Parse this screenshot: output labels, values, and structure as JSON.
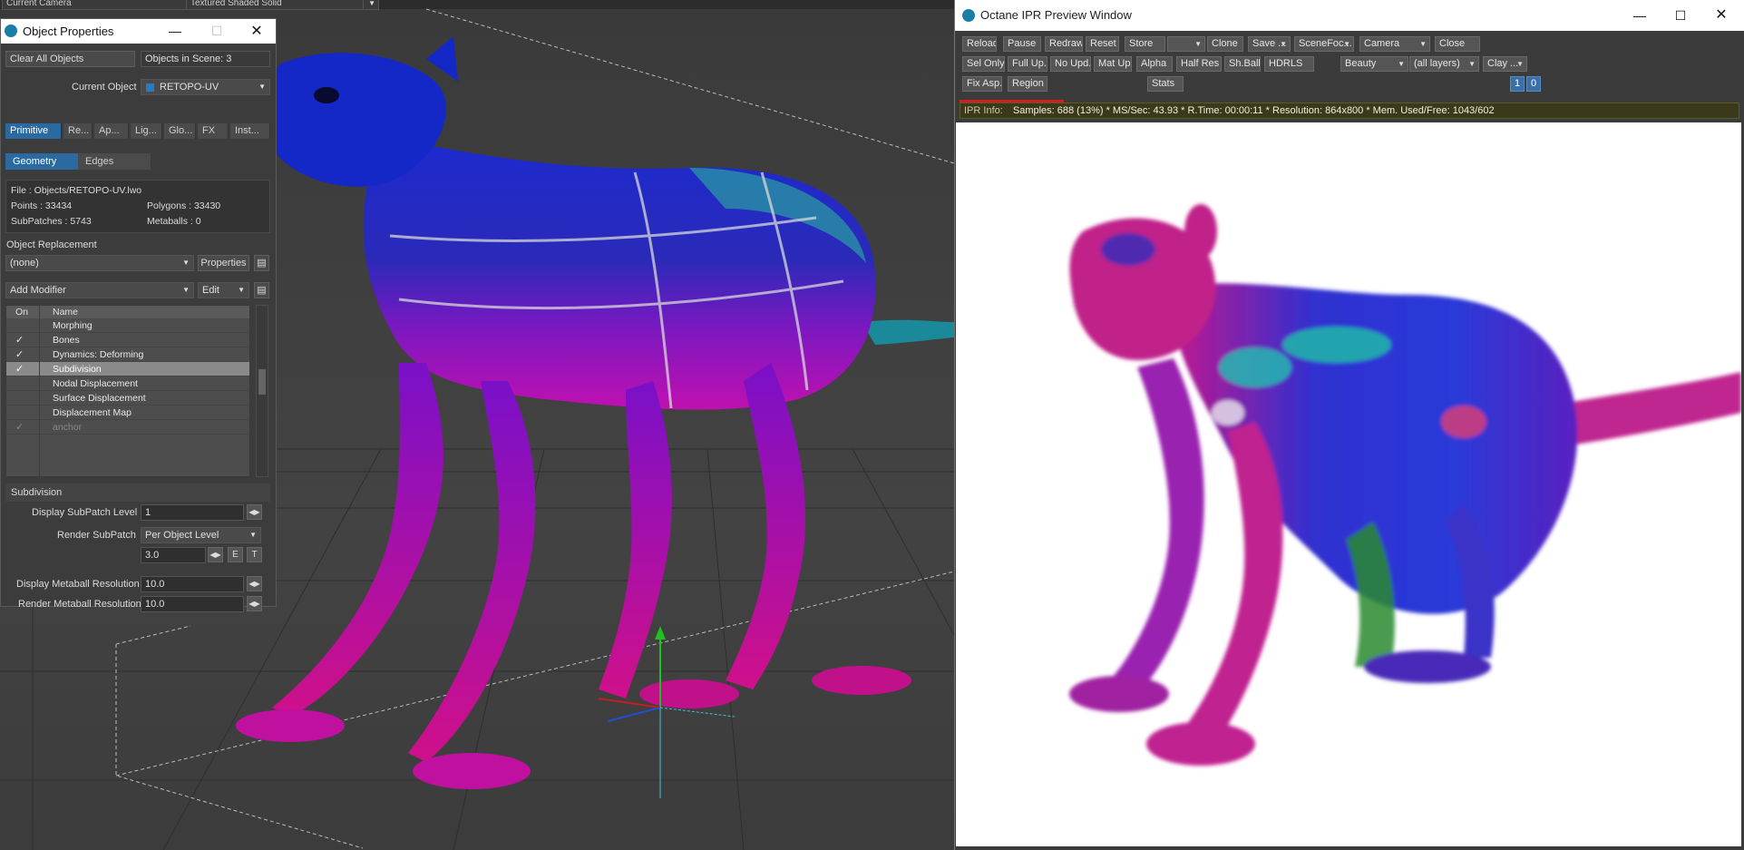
{
  "viewport": {
    "camera_label": "Current Camera",
    "shading_label": "Textured Shaded Solid"
  },
  "object_properties": {
    "title": "Object Properties",
    "clear_all_label": "Clear All Objects",
    "objects_in_scene": "Objects in Scene: 3",
    "current_object_label": "Current Object",
    "current_object_value": "RETOPO-UV",
    "tabs": [
      "Primitive",
      "Re...",
      "Ap...",
      "Lig...",
      "Glo...",
      "FX",
      "Inst..."
    ],
    "subtabs": [
      "Geometry",
      "Edges"
    ],
    "file": "File : Objects/RETOPO-UV.lwo",
    "points": "Points : 33434",
    "polygons": "Polygons : 33430",
    "subpatches": "SubPatches : 5743",
    "metaballs": "Metaballs : 0",
    "replacement_label": "Object Replacement",
    "replacement_value": "(none)",
    "properties_label": "Properties",
    "add_modifier_label": "Add Modifier",
    "edit_label": "Edit",
    "modifier_headers": {
      "on": "On",
      "name": "Name"
    },
    "modifiers": [
      {
        "name": "Morphing",
        "on": "",
        "state": "normal"
      },
      {
        "name": "Bones",
        "on": "✓",
        "state": "normal"
      },
      {
        "name": "Dynamics: Deforming",
        "on": "✓",
        "state": "normal"
      },
      {
        "name": "Subdivision",
        "on": "✓",
        "state": "selected"
      },
      {
        "name": "Nodal Displacement",
        "on": "",
        "state": "normal"
      },
      {
        "name": "Surface Displacement",
        "on": "",
        "state": "normal"
      },
      {
        "name": "Displacement Map",
        "on": "",
        "state": "normal"
      },
      {
        "name": "anchor",
        "on": "✓",
        "state": "dim"
      }
    ],
    "subdivision_section": "Subdivision",
    "display_subpatch_label": "Display SubPatch Level",
    "display_subpatch_value": "1",
    "render_subpatch_label": "Render SubPatch",
    "render_subpatch_value": "Per Object Level",
    "render_subpatch_number": "3.0",
    "e_label": "E",
    "t_label": "T",
    "display_metaball_label": "Display Metaball Resolution",
    "display_metaball_value": "10.0",
    "render_metaball_label": "Render Metaball Resolution",
    "render_metaball_value": "10.0"
  },
  "octane": {
    "title": "Octane IPR Preview Window",
    "row1": [
      "Reload",
      "Pause",
      "Redraw",
      "Reset",
      "Store",
      "",
      "Clone",
      "Save ...",
      "SceneFoc...",
      "Camera",
      "Close"
    ],
    "row2": [
      "Sel Only",
      "Full Up...",
      "No Upd..",
      "Mat Upd",
      "Alpha",
      "Half Res",
      "Sh.Ball",
      "HDRLS",
      "Beauty",
      "(all layers)",
      "Clay ..."
    ],
    "row3": [
      "Fix Asp..",
      "Region",
      "Stats",
      "1",
      "0"
    ],
    "ipr_label": "IPR Info:",
    "ipr_text": "Samples: 688 (13%)  *  MS/Sec: 43.93  *  R.Time: 00:00:11  *  Resolution: 864x800  *  Mem. Used/Free: 1043/602"
  },
  "colors": {
    "accent_tab": "#2b6aa0",
    "ipr_progress": "#d02020",
    "creature_blue": "#1a1aa8",
    "creature_magenta": "#b000b0"
  }
}
